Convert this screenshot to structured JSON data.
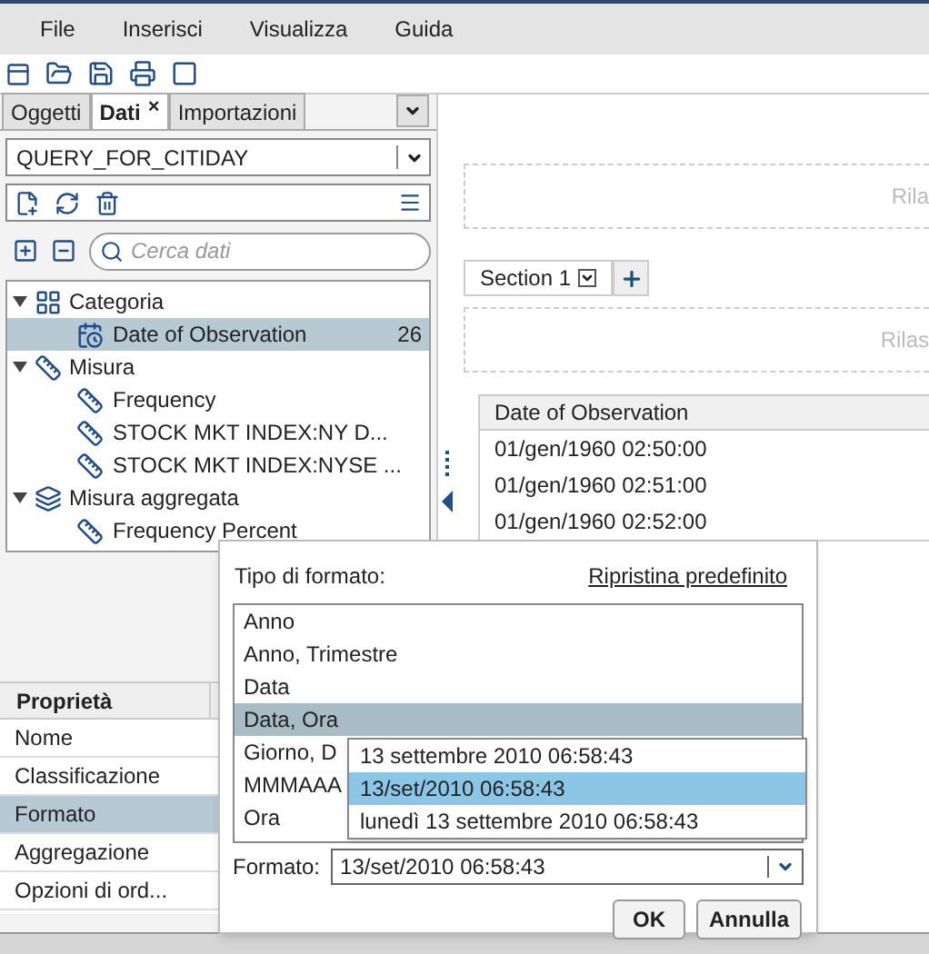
{
  "menu": [
    "File",
    "Inserisci",
    "Visualizza",
    "Guida"
  ],
  "tabs": [
    {
      "label": "Oggetti",
      "selected": false,
      "closable": false
    },
    {
      "label": "Dati",
      "selected": true,
      "closable": true
    },
    {
      "label": "Importazioni",
      "selected": false,
      "closable": false
    }
  ],
  "tab_close": "×",
  "data_source": {
    "value": "QUERY_FOR_CITIDAY"
  },
  "search": {
    "placeholder": "Cerca dati"
  },
  "tree": [
    {
      "label": "Categoria",
      "kind": "category",
      "expanded": true,
      "children": [
        {
          "label": "Date of Observation",
          "kind": "date",
          "count": "26",
          "selected": true
        }
      ]
    },
    {
      "label": "Misura",
      "kind": "measure",
      "expanded": true,
      "children": [
        {
          "label": "Frequency",
          "kind": "measure",
          "selected": false
        },
        {
          "label": "STOCK MKT INDEX:NY D...",
          "kind": "measure",
          "selected": false
        },
        {
          "label": "STOCK MKT INDEX:NYSE ...",
          "kind": "measure",
          "selected": false
        }
      ]
    },
    {
      "label": "Misura aggregata",
      "kind": "aggregate",
      "expanded": true,
      "children": [
        {
          "label": "Frequency Percent",
          "kind": "measure",
          "selected": false
        }
      ]
    }
  ],
  "properties": {
    "header": "Proprietà",
    "rows": [
      {
        "label": "Nome",
        "selected": false
      },
      {
        "label": "Classificazione",
        "selected": false
      },
      {
        "label": "Formato",
        "selected": true
      },
      {
        "label": "Aggregazione",
        "selected": false
      },
      {
        "label": "Opzioni di ord...",
        "selected": false
      }
    ]
  },
  "canvas": {
    "drop_zone_top": "Rila",
    "section_tab": "Section 1",
    "drop_zone_section": "Rilas",
    "table": {
      "column": "Date of Observation",
      "rows": [
        "01/gen/1960 02:50:00",
        "01/gen/1960 02:51:00",
        "01/gen/1960 02:52:00"
      ]
    }
  },
  "format_dialog": {
    "type_label": "Tipo di formato:",
    "reset_link": "Ripristina predefinito",
    "types": [
      {
        "label": "Anno",
        "selected": false
      },
      {
        "label": "Anno, Trimestre",
        "selected": false
      },
      {
        "label": "Data",
        "selected": false
      },
      {
        "label": "Data, Ora",
        "selected": true
      },
      {
        "label": "Giorno, D",
        "selected": false
      },
      {
        "label": "MMMAAA",
        "selected": false
      },
      {
        "label": "Ora",
        "selected": false
      }
    ],
    "format_options": [
      {
        "label": "13 settembre 2010 06:58:43",
        "selected": false
      },
      {
        "label": "13/set/2010 06:58:43",
        "selected": true
      },
      {
        "label": "lunedì 13 settembre 2010 06:58:43",
        "selected": false
      }
    ],
    "format_label": "Formato:",
    "format_value": "13/set/2010 06:58:43",
    "buttons": [
      "OK",
      "Annulla"
    ]
  }
}
